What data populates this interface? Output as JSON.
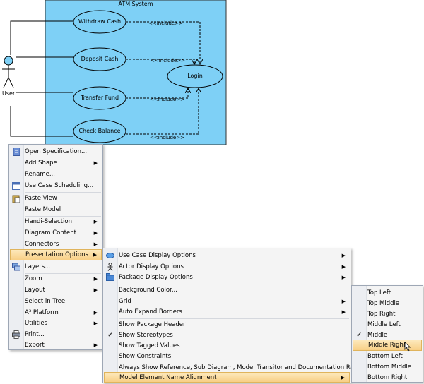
{
  "diagram": {
    "system_title": "ATM System",
    "actor": "User",
    "use_cases": [
      "Withdraw Cash",
      "Deposit Cash",
      "Transfer Fund",
      "Check Balance"
    ],
    "included_use_case": "Login",
    "include_label": "<<Include>>"
  },
  "colors": {
    "system_fill": "#7ed0f6",
    "menu_highlight": "#f8cf86",
    "menu_bg": "#f4f4f4"
  },
  "context_menu": {
    "items": [
      {
        "label": "Open Specification...",
        "icon": "spec-icon",
        "submenu": false
      },
      {
        "label": "Add Shape",
        "submenu": true
      },
      {
        "label": "Rename...",
        "submenu": false
      },
      {
        "label": "Use Case Scheduling...",
        "icon": "scheduling-icon",
        "submenu": false
      },
      {
        "label": "Paste View",
        "icon": "paste-icon",
        "submenu": false
      },
      {
        "label": "Paste Model",
        "submenu": false
      },
      {
        "label": "Handi-Selection",
        "submenu": true
      },
      {
        "label": "Diagram Content",
        "submenu": true
      },
      {
        "label": "Connectors",
        "submenu": true
      },
      {
        "label": "Presentation Options",
        "submenu": true,
        "highlighted": true
      },
      {
        "label": "Layers...",
        "icon": "layers-icon",
        "submenu": false
      },
      {
        "label": "Zoom",
        "submenu": true
      },
      {
        "label": "Layout",
        "submenu": true
      },
      {
        "label": "Select in Tree",
        "submenu": false
      },
      {
        "label": "A³ Platform",
        "submenu": true
      },
      {
        "label": "Utilities",
        "submenu": true
      },
      {
        "label": "Print...",
        "icon": "print-icon",
        "submenu": false
      },
      {
        "label": "Export",
        "submenu": true
      }
    ]
  },
  "presentation_menu": {
    "items": [
      {
        "label": "Use Case Display Options",
        "icon": "use-case-icon",
        "submenu": true
      },
      {
        "label": "Actor Display Options",
        "icon": "actor-icon",
        "submenu": true
      },
      {
        "label": "Package Display Options",
        "icon": "package-icon",
        "submenu": true
      },
      {
        "label": "Background Color...",
        "submenu": false
      },
      {
        "label": "Grid",
        "submenu": true
      },
      {
        "label": "Auto Expand Borders",
        "submenu": true
      },
      {
        "label": "Show Package Header",
        "submenu": false
      },
      {
        "label": "Show Stereotypes",
        "submenu": false,
        "checked": true
      },
      {
        "label": "Show Tagged Values",
        "submenu": false
      },
      {
        "label": "Show Constraints",
        "submenu": false
      },
      {
        "label": "Always Show Reference, Sub Diagram, Model Transitor and Documentation Resource",
        "submenu": false
      },
      {
        "label": "Model Element Name Alignment",
        "submenu": true,
        "highlighted": true
      }
    ]
  },
  "alignment_menu": {
    "items": [
      {
        "label": "Top Left"
      },
      {
        "label": "Top Middle"
      },
      {
        "label": "Top Right"
      },
      {
        "label": "Middle Left"
      },
      {
        "label": "Middle",
        "checked": true
      },
      {
        "label": "Middle Right",
        "highlighted": true
      },
      {
        "label": "Bottom Left"
      },
      {
        "label": "Bottom Middle"
      },
      {
        "label": "Bottom Right"
      }
    ]
  }
}
